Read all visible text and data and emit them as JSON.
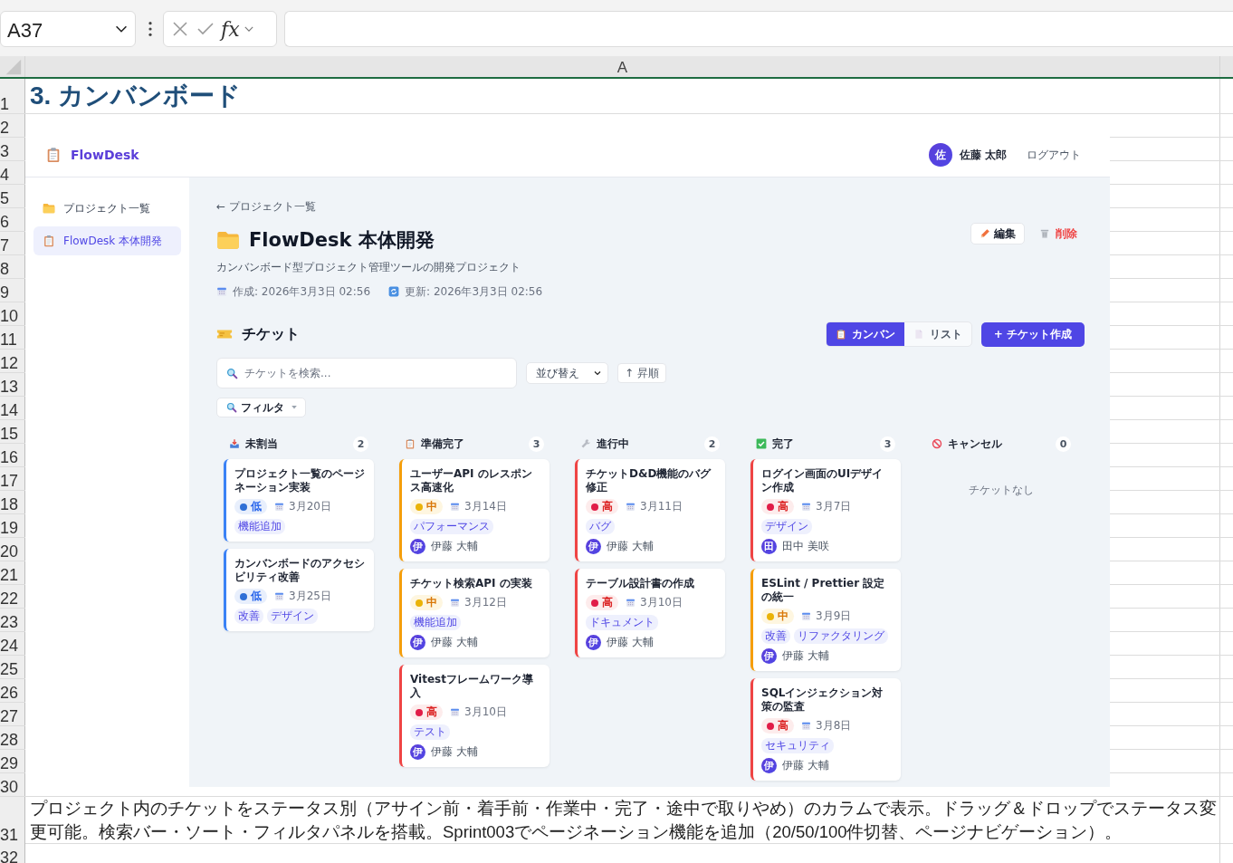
{
  "formula_bar": {
    "name_box": "A37",
    "function_label": "fx"
  },
  "column_headers": [
    "A"
  ],
  "rows": [
    {
      "number": "1",
      "kind": "title",
      "text": "3. カンバンボード"
    },
    {
      "number": "2",
      "kind": "plain"
    },
    {
      "number": "3",
      "kind": "plain"
    },
    {
      "number": "4",
      "kind": "plain"
    },
    {
      "number": "5",
      "kind": "plain"
    },
    {
      "number": "6",
      "kind": "plain"
    },
    {
      "number": "7",
      "kind": "plain"
    },
    {
      "number": "8",
      "kind": "plain"
    },
    {
      "number": "9",
      "kind": "plain"
    },
    {
      "number": "10",
      "kind": "plain"
    },
    {
      "number": "11",
      "kind": "plain"
    },
    {
      "number": "12",
      "kind": "plain"
    },
    {
      "number": "13",
      "kind": "plain"
    },
    {
      "number": "14",
      "kind": "plain"
    },
    {
      "number": "15",
      "kind": "plain"
    },
    {
      "number": "16",
      "kind": "plain"
    },
    {
      "number": "17",
      "kind": "plain"
    },
    {
      "number": "18",
      "kind": "plain"
    },
    {
      "number": "19",
      "kind": "plain"
    },
    {
      "number": "20",
      "kind": "plain"
    },
    {
      "number": "21",
      "kind": "plain"
    },
    {
      "number": "22",
      "kind": "plain"
    },
    {
      "number": "23",
      "kind": "plain"
    },
    {
      "number": "24",
      "kind": "plain"
    },
    {
      "number": "25",
      "kind": "plain"
    },
    {
      "number": "26",
      "kind": "plain"
    },
    {
      "number": "27",
      "kind": "plain"
    },
    {
      "number": "28",
      "kind": "plain"
    },
    {
      "number": "29",
      "kind": "plain"
    },
    {
      "number": "30",
      "kind": "plain"
    },
    {
      "number": "31",
      "kind": "note",
      "text": "プロジェクト内のチケットをステータス別（アサイン前・着手前・作業中・完了・途中で取りやめ）のカラムで表示。ドラッグ＆ドロップでステータス変更可能。検索バー・ソート・フィルタパネルを搭載。Sprint003でページネーション機能を追加（20/50/100件切替、ページナビゲーション）。"
    },
    {
      "number": "32",
      "kind": "plain"
    }
  ],
  "app": {
    "brand": "FlowDesk",
    "user": {
      "initial": "佐",
      "name": "佐藤 太郎"
    },
    "logout": "ログアウト",
    "sidebar": [
      {
        "label": "プロジェクト一覧",
        "selected": false
      },
      {
        "label": "FlowDesk 本体開発",
        "selected": true
      }
    ],
    "back_link": "← プロジェクト一覧",
    "title": "FlowDesk 本体開発",
    "edit_button": "編集",
    "delete_button": "削除",
    "description": "カンバンボード型プロジェクト管理ツールの開発プロジェクト",
    "created": "作成: 2026年3月3日 02:56",
    "updated": "更新: 2026年3月3日 02:56",
    "tickets_heading": "チケット",
    "view_toggle": [
      {
        "label": "カンバン",
        "selected": true
      },
      {
        "label": "リスト",
        "selected": false
      }
    ],
    "create_button": "+ チケット作成",
    "search": {
      "placeholder": "チケットを検索..."
    },
    "sort_select": "並び替え",
    "order_button": "↑ 昇順",
    "filter_button": "フィルタ",
    "columns": [
      {
        "title": "未割当",
        "count": "2",
        "cards": [
          {
            "title": "プロジェクト一覧のページネーション実装",
            "priority": {
              "label": "低",
              "kind": "low"
            },
            "due": "3月20日",
            "tags": [
              "機能追加"
            ]
          },
          {
            "title": "カンバンボードのアクセシビリティ改善",
            "priority": {
              "label": "低",
              "kind": "low"
            },
            "due": "3月25日",
            "tags": [
              "改善",
              "デザイン"
            ]
          }
        ]
      },
      {
        "title": "準備完了",
        "count": "3",
        "cards": [
          {
            "title": "ユーザーAPI のレスポンス高速化",
            "priority": {
              "label": "中",
              "kind": "medium"
            },
            "due": "3月14日",
            "tags": [
              "パフォーマンス"
            ],
            "assignee": {
              "initial": "伊",
              "name": "伊藤 大輔"
            }
          },
          {
            "title": "チケット検索API の実装",
            "priority": {
              "label": "中",
              "kind": "medium"
            },
            "due": "3月12日",
            "tags": [
              "機能追加"
            ],
            "assignee": {
              "initial": "伊",
              "name": "伊藤 大輔"
            }
          },
          {
            "title": "Vitestフレームワーク導入",
            "priority": {
              "label": "高",
              "kind": "high"
            },
            "due": "3月10日",
            "tags": [
              "テスト"
            ],
            "assignee": {
              "initial": "伊",
              "name": "伊藤 大輔"
            }
          }
        ]
      },
      {
        "title": "進行中",
        "count": "2",
        "cards": [
          {
            "title": "チケットD&D機能のバグ修正",
            "priority": {
              "label": "高",
              "kind": "high"
            },
            "due": "3月11日",
            "tags": [
              "バグ"
            ],
            "assignee": {
              "initial": "伊",
              "name": "伊藤 大輔"
            }
          },
          {
            "title": "テーブル設計書の作成",
            "priority": {
              "label": "高",
              "kind": "high"
            },
            "due": "3月10日",
            "tags": [
              "ドキュメント"
            ],
            "assignee": {
              "initial": "伊",
              "name": "伊藤 大輔"
            }
          }
        ]
      },
      {
        "title": "完了",
        "count": "3",
        "cards": [
          {
            "title": "ログイン画面のUIデザイン作成",
            "priority": {
              "label": "高",
              "kind": "high"
            },
            "due": "3月7日",
            "tags": [
              "デザイン"
            ],
            "assignee": {
              "initial": "田",
              "name": "田中 美咲"
            }
          },
          {
            "title": "ESLint / Prettier 設定の統一",
            "priority": {
              "label": "中",
              "kind": "medium"
            },
            "due": "3月9日",
            "tags": [
              "改善",
              "リファクタリング"
            ],
            "assignee": {
              "initial": "伊",
              "name": "伊藤 大輔"
            }
          },
          {
            "title": "SQLインジェクション対策の監査",
            "priority": {
              "label": "高",
              "kind": "high"
            },
            "due": "3月8日",
            "tags": [
              "セキュリティ"
            ],
            "assignee": {
              "initial": "伊",
              "name": "伊藤 大輔"
            }
          }
        ]
      },
      {
        "title": "キャンセル",
        "count": "0",
        "empty_text": "チケットなし"
      }
    ]
  }
}
